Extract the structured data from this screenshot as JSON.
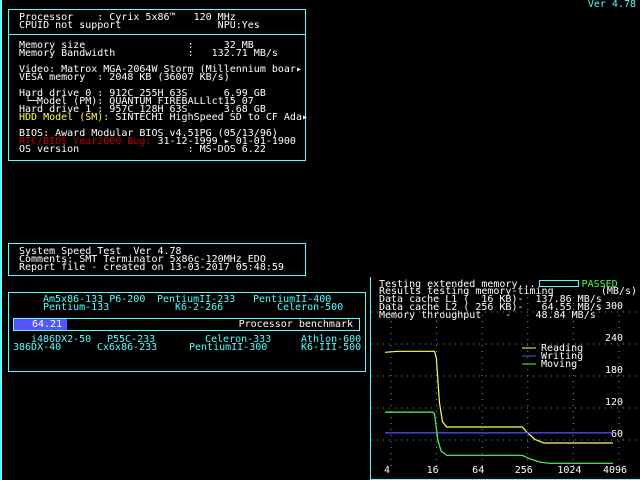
{
  "version": "Ver 4.78",
  "sysinfo": {
    "cpu": "Processor    : Cyrix 5x86™   120 MHz",
    "cpuid": "CPUID not support                NPU:Yes",
    "mem_size": "Memory size                 :     32 MB",
    "mem_bw": "Memory Bandwidth            :   132.71 MB/s",
    "video": "Video: Matrox MGA-2064W Storm (Millennium boar▸",
    "vesa": "VESA memory  : 2048 KB (36007 KB/s)",
    "hd0": "Hard drive 0 : 912C 255H 63S      6.99 GB",
    "hd0_model": " └─Model (PM): QUANTUM FIREBALLlct15 07",
    "hd1": "Hard drive 1 : 957C 128H 63S      3.68 GB",
    "hdd_sm_label": "HDD Model (SM):",
    "hdd_sm_value": " SINTECHI HighSpeed SD to CF Ada▸",
    "bios": "BIOS: Award Modular BIOS v4.51PG (05/13/96)",
    "y2k_label": "RTC/BIOS Year2000 Bug:",
    "y2k_value": " 31-12-1999 ▸ 01-01-1900",
    "os": "OS version                  : MS-DOS 6.22"
  },
  "report": {
    "title": "System Speed Test  Ver 4.78",
    "comments": "Comments: SMT Terminator 5x86c-120MHz EDO",
    "created": "Report file - created on 13-03-2017 05:48:59"
  },
  "benchmark": {
    "score": "64.21",
    "score_fraction": 0.155,
    "label": "Processor benchmark",
    "top": [
      "Am5x86-133 P6-200",
      "Pentium-133",
      "PentiumII-233",
      "K6-2-266",
      "PentiumII-400",
      "Celeron-500"
    ],
    "bottom": [
      "i486DX2-50",
      "386DX-40",
      "P55C-233",
      "Cx6x86-233",
      "Celeron-333",
      "PentiumII-300",
      "Athlon-600",
      "K6-III-500"
    ]
  },
  "memtest": {
    "testing": "Testing extended memory...",
    "status": "PASSED",
    "results": "Results testing memory-timing",
    "unit": "(MB/s)",
    "l1": "Data cache L1 (  16 KB)-  137.86 MB/s",
    "l2": "Data cache L2 ( 256 KB)-   64.55 MB/s",
    "thr": "Memory throughput    -    48.84 MB/s"
  },
  "chart_data": {
    "type": "line",
    "xscale": "log2",
    "xlabel": "KB",
    "ylabel": "MB/s",
    "x_ticks": [
      4,
      16,
      64,
      256,
      1024,
      4096
    ],
    "y_ticks": [
      60,
      120,
      180,
      240,
      300
    ],
    "ylim": [
      0,
      300
    ],
    "xlim": [
      4,
      4096
    ],
    "legend": [
      "Reading",
      "Writing",
      "Moving"
    ],
    "series": [
      {
        "name": "Reading",
        "color": "#ffff55",
        "points": [
          [
            4,
            215
          ],
          [
            6,
            217
          ],
          [
            18,
            217
          ],
          [
            19,
            205
          ],
          [
            21,
            120
          ],
          [
            23,
            85
          ],
          [
            26,
            75
          ],
          [
            260,
            75
          ],
          [
            300,
            65
          ],
          [
            380,
            52
          ],
          [
            500,
            45
          ],
          [
            4096,
            45
          ]
        ]
      },
      {
        "name": "Writing",
        "color": "#5555ff",
        "points": [
          [
            4,
            64
          ],
          [
            4096,
            64
          ]
        ]
      },
      {
        "name": "Moving",
        "color": "#55ff55",
        "points": [
          [
            4,
            103
          ],
          [
            17,
            103
          ],
          [
            18,
            100
          ],
          [
            20,
            50
          ],
          [
            22,
            30
          ],
          [
            26,
            22
          ],
          [
            260,
            22
          ],
          [
            330,
            15
          ],
          [
            450,
            9
          ],
          [
            600,
            7
          ],
          [
            4096,
            7
          ]
        ]
      }
    ]
  }
}
